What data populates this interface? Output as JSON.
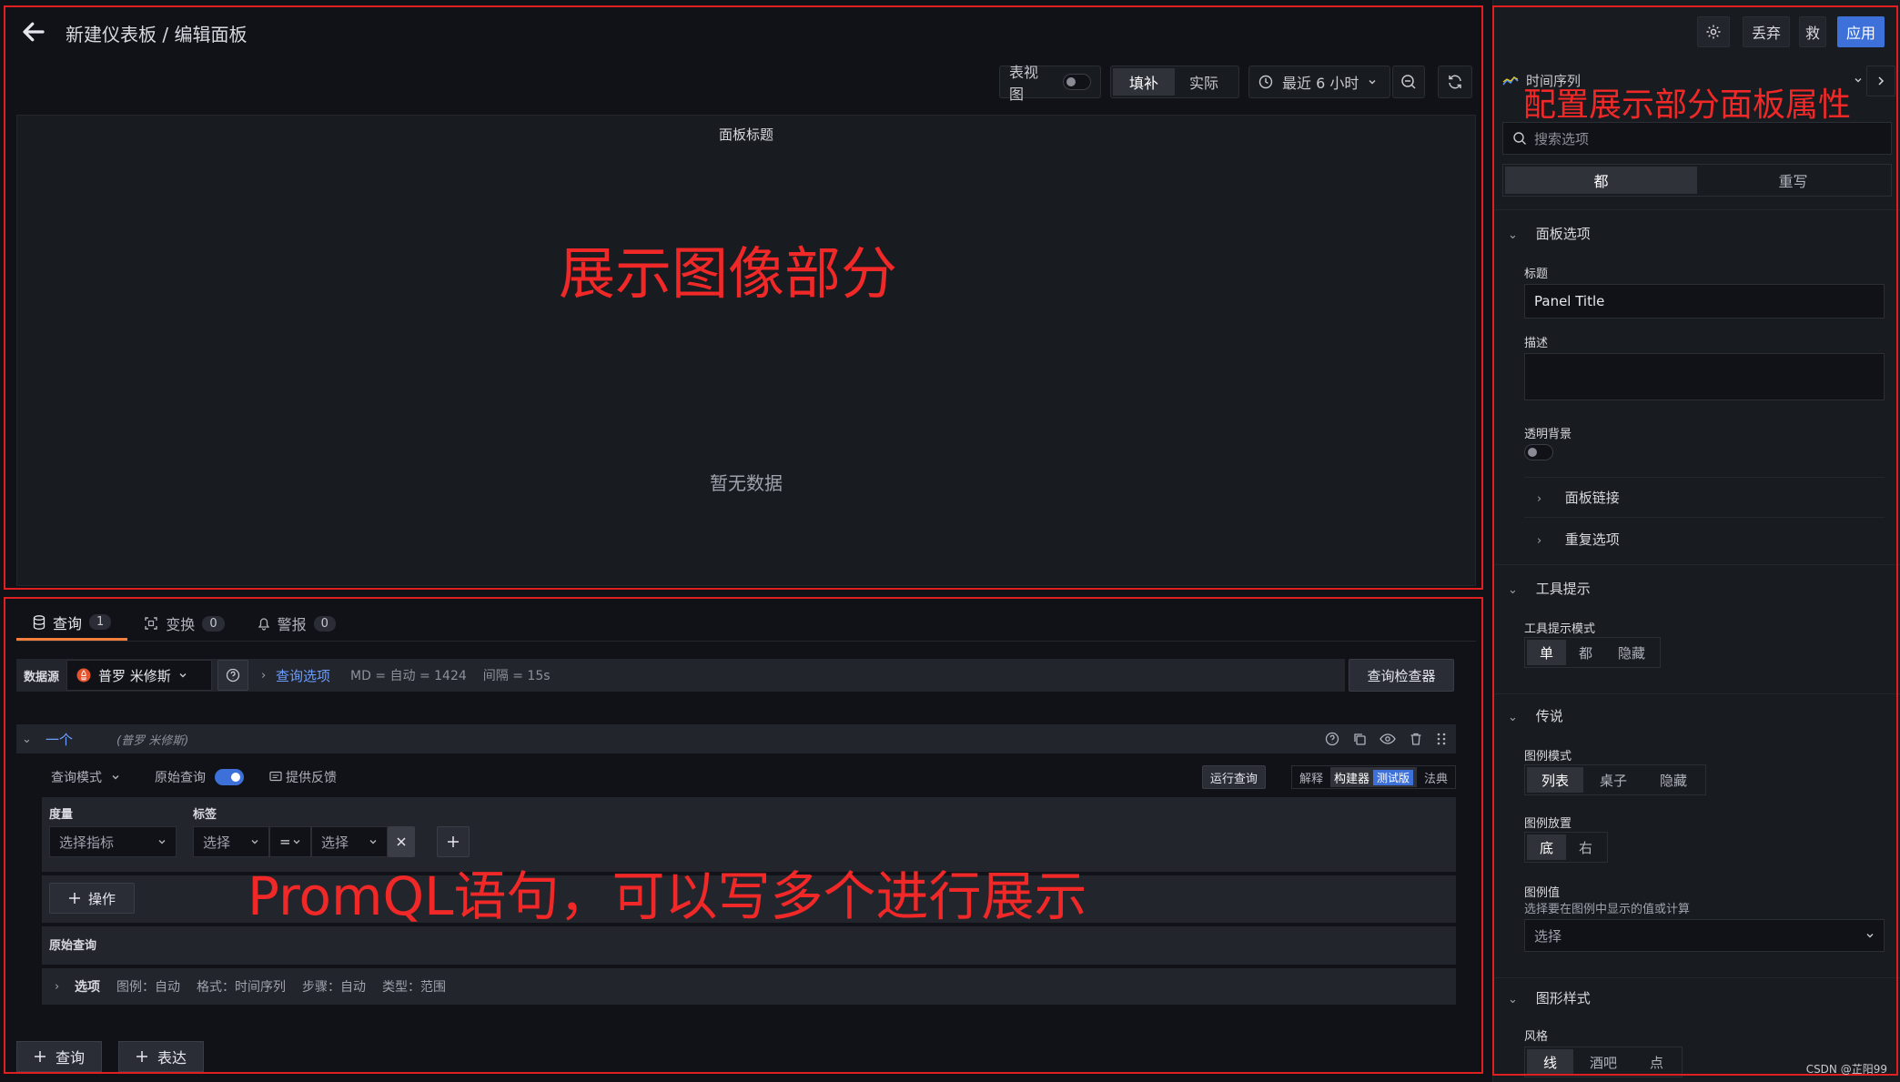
{
  "header": {
    "title": "新建仪表板 / 编辑面板"
  },
  "toolbar": {
    "table_view": "表视图",
    "fill": "填补",
    "actual": "实际",
    "time_range": "最近 6 小时"
  },
  "preview": {
    "panel_title": "面板标题",
    "no_data": "暂无数据"
  },
  "tabs": [
    {
      "label": "查询",
      "count": "1"
    },
    {
      "label": "变换",
      "count": "0"
    },
    {
      "label": "警报",
      "count": "0"
    }
  ],
  "query": {
    "datasource_label": "数据源",
    "datasource": "普罗 米修斯",
    "query_options": "查询选项",
    "md_info": "MD = 自动 = 1424",
    "interval": "间隔 = 15s",
    "inspector": "查询检查器",
    "name": "一个",
    "source_hint": "(普罗 米修斯)",
    "mode": "查询模式",
    "raw_query_label": "原始查询",
    "feedback": "提供反馈",
    "run": "运行查询",
    "explain": "解释",
    "builder": "构建器",
    "beta": "测试版",
    "code": "法典",
    "metric_label": "度量",
    "metric_placeholder": "选择指标",
    "labels_label": "标签",
    "label_select": "选择",
    "operator": "=",
    "value_select": "选择",
    "operations": "操作",
    "raw_query": "原始查询",
    "options_title": "选项",
    "options": [
      "图例：自动",
      "格式：时间序列",
      "步骤：自动",
      "类型：范围"
    ],
    "add_query": "查询",
    "add_expression": "表达"
  },
  "sidebar": {
    "discard": "丢弃",
    "save": "救",
    "apply": "应用",
    "viz_type": "时间序列",
    "search_placeholder": "搜索选项",
    "filter_all": "都",
    "filter_overrides": "重写",
    "panel_options": "面板选项",
    "title_label": "标题",
    "title_value": "Panel Title",
    "desc_label": "描述",
    "transparent_label": "透明背景",
    "panel_links": "面板链接",
    "repeat_options": "重复选项",
    "tooltip": "工具提示",
    "tooltip_mode_label": "工具提示模式",
    "tooltip_modes": [
      "单",
      "都",
      "隐藏"
    ],
    "legend": "传说",
    "legend_mode_label": "图例模式",
    "legend_modes": [
      "列表",
      "桌子",
      "隐藏"
    ],
    "legend_placement_label": "图例放置",
    "legend_placements": [
      "底",
      "右"
    ],
    "legend_values_label": "图例值",
    "legend_values_desc": "选择要在图例中显示的值或计算",
    "legend_values_placeholder": "选择",
    "graph_styles": "图形样式",
    "style_label": "风格",
    "styles": [
      "线",
      "酒吧",
      "点"
    ]
  },
  "annotations": {
    "preview": "展示图像部分",
    "sidebar": "配置展示部分面板属性",
    "query": "PromQL语句，可以写多个进行展示"
  },
  "watermark": "CSDN @芷阳99",
  "colors": {
    "accent": "#3d71d9",
    "tab_underline": "#f5803e",
    "annotation": "#e02020"
  }
}
